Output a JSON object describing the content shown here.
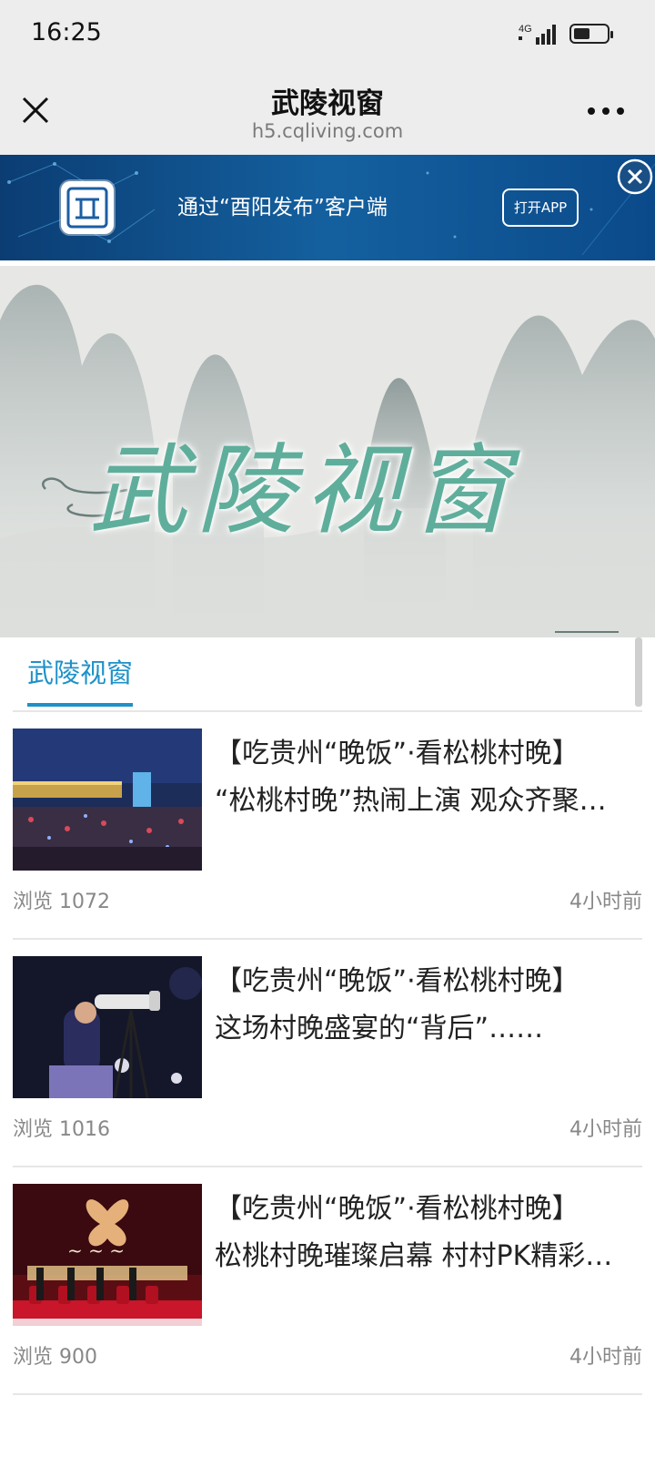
{
  "status_bar": {
    "time": "16:25",
    "network": "4G"
  },
  "nav": {
    "title": "武陵视窗",
    "url": "h5.cqliving.com"
  },
  "app_banner": {
    "text": "通过“酉阳发布”客户端",
    "open_label": "打开APP"
  },
  "hero": {
    "title": "武陵视窗"
  },
  "tabs": [
    {
      "label": "武陵视窗"
    }
  ],
  "articles": [
    {
      "title_line1": "【吃贵州“晚饭”·看松桃村晚】",
      "title_line2": "“松桃村晚”热闹上演 观众齐聚…",
      "views": "浏览 1072",
      "time": "4小时前"
    },
    {
      "title_line1": "【吃贵州“晚饭”·看松桃村晚】",
      "title_line2": "这场村晚盛宴的“背后”……",
      "views": "浏览 1016",
      "time": "4小时前"
    },
    {
      "title_line1": "【吃贵州“晚饭”·看松桃村晚】",
      "title_line2": "松桃村晚璀璨启幕 村村PK精彩…",
      "views": "浏览 900",
      "time": "4小时前"
    }
  ],
  "colors": {
    "accent": "#1e91c9",
    "hero_text": "#5fae9c",
    "banner_bg": "#0f4f8c"
  }
}
